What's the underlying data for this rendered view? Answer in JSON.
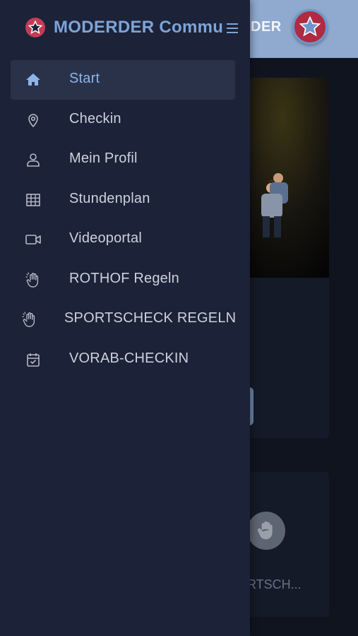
{
  "background": {
    "topbar_text": "DER",
    "card2_text": "RTSCH..."
  },
  "drawer": {
    "title": "MODERDER Community",
    "items": [
      {
        "label": "Start",
        "icon": "home-icon",
        "active": true
      },
      {
        "label": "Checkin",
        "icon": "map-pin-icon"
      },
      {
        "label": "Mein Profil",
        "icon": "user-icon"
      },
      {
        "label": "Stundenplan",
        "icon": "table-grid-icon"
      },
      {
        "label": "Videoportal",
        "icon": "video-camera-icon"
      },
      {
        "label": "ROTHOF Regeln",
        "icon": "raised-hand-icon"
      },
      {
        "label": "SPORTSCHECK REGELN",
        "icon": "raised-hand-icon"
      },
      {
        "label": "VORAB-CHECKIN",
        "icon": "calendar-check-icon"
      }
    ]
  },
  "colors": {
    "drawer_bg": "#1c2237",
    "active_bg": "#2a324a",
    "accent": "#7ea4d8",
    "topbar": "#8fa9cf",
    "brand_red": "#c73a55"
  }
}
